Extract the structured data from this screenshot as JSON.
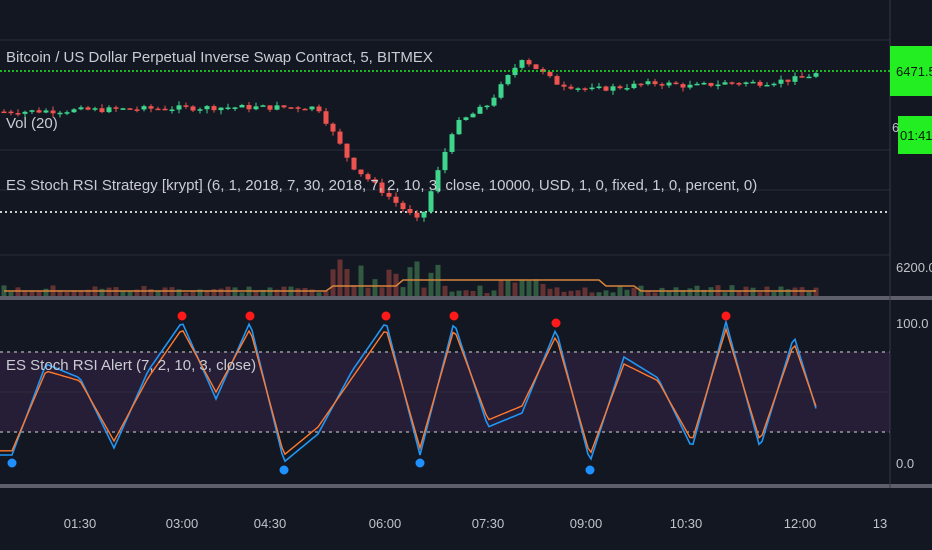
{
  "colors": {
    "background": "#131722",
    "up": "#26a69a",
    "up_bright": "#3dd68c",
    "down": "#ef5350",
    "price_line": "#22ee22",
    "stoch_k": "#2196f3",
    "stoch_d": "#ff7a2e",
    "band_fill": "#2a1f3a",
    "dot_sell": "#ff1a1a",
    "dot_buy": "#1e90ff"
  },
  "header": {
    "symbol_title": "Bitcoin / US Dollar Perpetual Inverse Swap Contract, 5, BITMEX",
    "vol_label": "Vol (20)",
    "strategy_label": "ES Stoch RSI Strategy [krypt] (6, 1, 2018, 7, 30, 2018, 7, 2, 10, 3, close, 10000, USD, 1, 0, fixed, 1, 0, percent, 0)",
    "alert_label": "ES Stoch RSI Alert (7, 2, 10, 3, close)"
  },
  "price_scale": {
    "current_price": "6471.5",
    "countdown": "01:41",
    "partial_tick": "6",
    "low_tick": "6200.0"
  },
  "oscillator_scale": {
    "top": "100.0",
    "bottom": "0.0"
  },
  "time_axis": {
    "ticks": [
      "01:30",
      "03:00",
      "04:30",
      "06:00",
      "07:30",
      "09:00",
      "10:30",
      "12:00",
      "13"
    ]
  },
  "chart_data": [
    {
      "type": "line",
      "name_hint": "price_candles",
      "x": [
        "00:30",
        "01:00",
        "01:30",
        "02:00",
        "02:30",
        "03:00",
        "03:30",
        "04:00",
        "04:30",
        "05:00",
        "05:30",
        "06:00",
        "06:30",
        "07:00",
        "07:30",
        "08:00",
        "08:30",
        "09:00",
        "09:30",
        "10:00",
        "10:30",
        "11:00",
        "11:30",
        "12:00",
        "12:30"
      ],
      "values": [
        6415,
        6416,
        6417,
        6418,
        6419,
        6420,
        6421,
        6421,
        6421,
        6421,
        6340,
        6300,
        6260,
        6395,
        6425,
        6490,
        6455,
        6445,
        6450,
        6455,
        6450,
        6455,
        6455,
        6460,
        6471.5
      ],
      "current_price": 6471.5
    },
    {
      "type": "line",
      "name_hint": "stoch_rsi",
      "series": [
        {
          "x": [
            "00:30",
            "01:00",
            "01:30",
            "02:00",
            "02:30",
            "03:00",
            "03:30",
            "04:00",
            "04:30",
            "05:00",
            "05:30",
            "06:00",
            "06:30",
            "07:00",
            "07:30",
            "08:00",
            "08:30",
            "09:00",
            "09:30",
            "10:00",
            "10:30",
            "11:00",
            "11:30",
            "12:00",
            "12:30"
          ],
          "values": [
            5,
            70,
            60,
            10,
            65,
            100,
            45,
            100,
            0,
            20,
            65,
            100,
            5,
            100,
            25,
            35,
            95,
            0,
            75,
            60,
            10,
            100,
            10,
            90,
            10
          ]
        },
        {
          "x": [
            "00:30",
            "01:00",
            "01:30",
            "02:00",
            "02:30",
            "03:00",
            "03:30",
            "04:00",
            "04:30",
            "05:00",
            "05:30",
            "06:00",
            "06:30",
            "07:00",
            "07:30",
            "08:00",
            "08:30",
            "09:00",
            "09:30",
            "10:00",
            "10:30",
            "11:00",
            "11:30",
            "12:00",
            "12:30"
          ],
          "values": [
            8,
            65,
            58,
            15,
            60,
            95,
            50,
            95,
            5,
            25,
            60,
            95,
            10,
            95,
            30,
            40,
            90,
            5,
            70,
            58,
            15,
            95,
            15,
            85,
            15
          ]
        }
      ],
      "ylim": [
        0,
        100
      ],
      "bands": [
        20,
        80
      ]
    }
  ]
}
